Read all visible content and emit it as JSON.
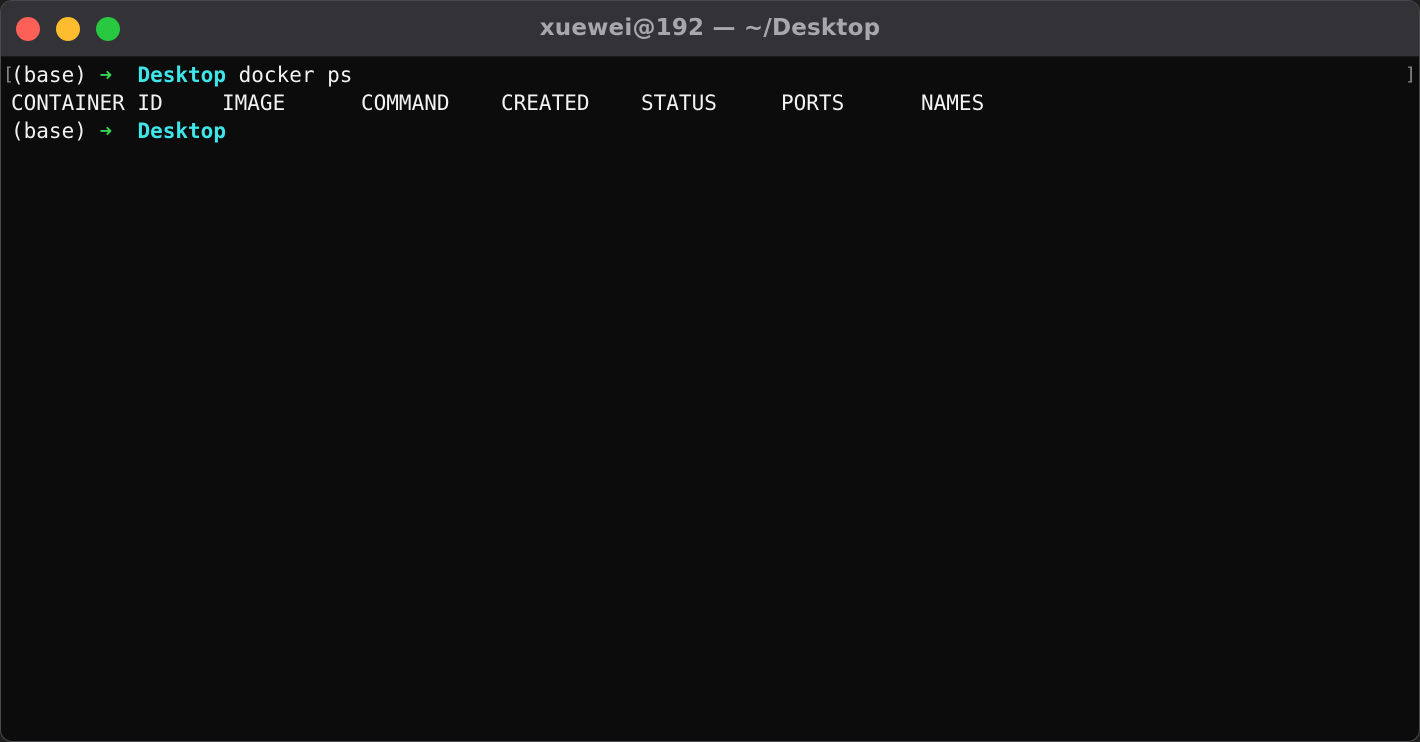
{
  "window": {
    "title": "xuewei@192 — ~/Desktop"
  },
  "colors": {
    "close": "#fe5f57",
    "minimize": "#febc2e",
    "zoom": "#28c840",
    "prompt_arrow": "#39d353",
    "prompt_dir": "#3ee6ea",
    "text": "#f2f2f2",
    "background": "#0c0c0c"
  },
  "terminal": {
    "lines": [
      {
        "env": "(base)",
        "arrow": "➜",
        "dir": "Desktop",
        "command": "docker ps"
      },
      {
        "env": "(base)",
        "arrow": "➜",
        "dir": "Desktop",
        "command": ""
      }
    ],
    "docker_header": [
      "CONTAINER ID",
      "IMAGE",
      "COMMAND",
      "CREATED",
      "STATUS",
      "PORTS",
      "NAMES"
    ],
    "mark_left": "[",
    "mark_right": "]"
  }
}
